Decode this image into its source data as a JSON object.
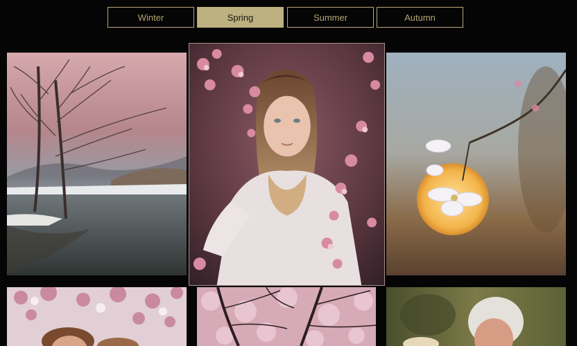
{
  "tabs": [
    {
      "label": "Winter",
      "active": false
    },
    {
      "label": "Spring",
      "active": true
    },
    {
      "label": "Summer",
      "active": false
    },
    {
      "label": "Autumn",
      "active": false
    }
  ],
  "colors": {
    "background": "#050505",
    "tab_border": "#b8aa7c",
    "tab_active_bg": "#bdb081",
    "tab_text": "#b4a472"
  },
  "gallery": {
    "images": [
      {
        "name": "winter-trees-river-photo"
      },
      {
        "name": "girl-with-blossoms-photo"
      },
      {
        "name": "blossom-against-sunset-photo"
      },
      {
        "name": "couple-under-blossoms-photo"
      },
      {
        "name": "cherry-blossom-branches-photo"
      },
      {
        "name": "elderly-couple-photo"
      }
    ]
  }
}
